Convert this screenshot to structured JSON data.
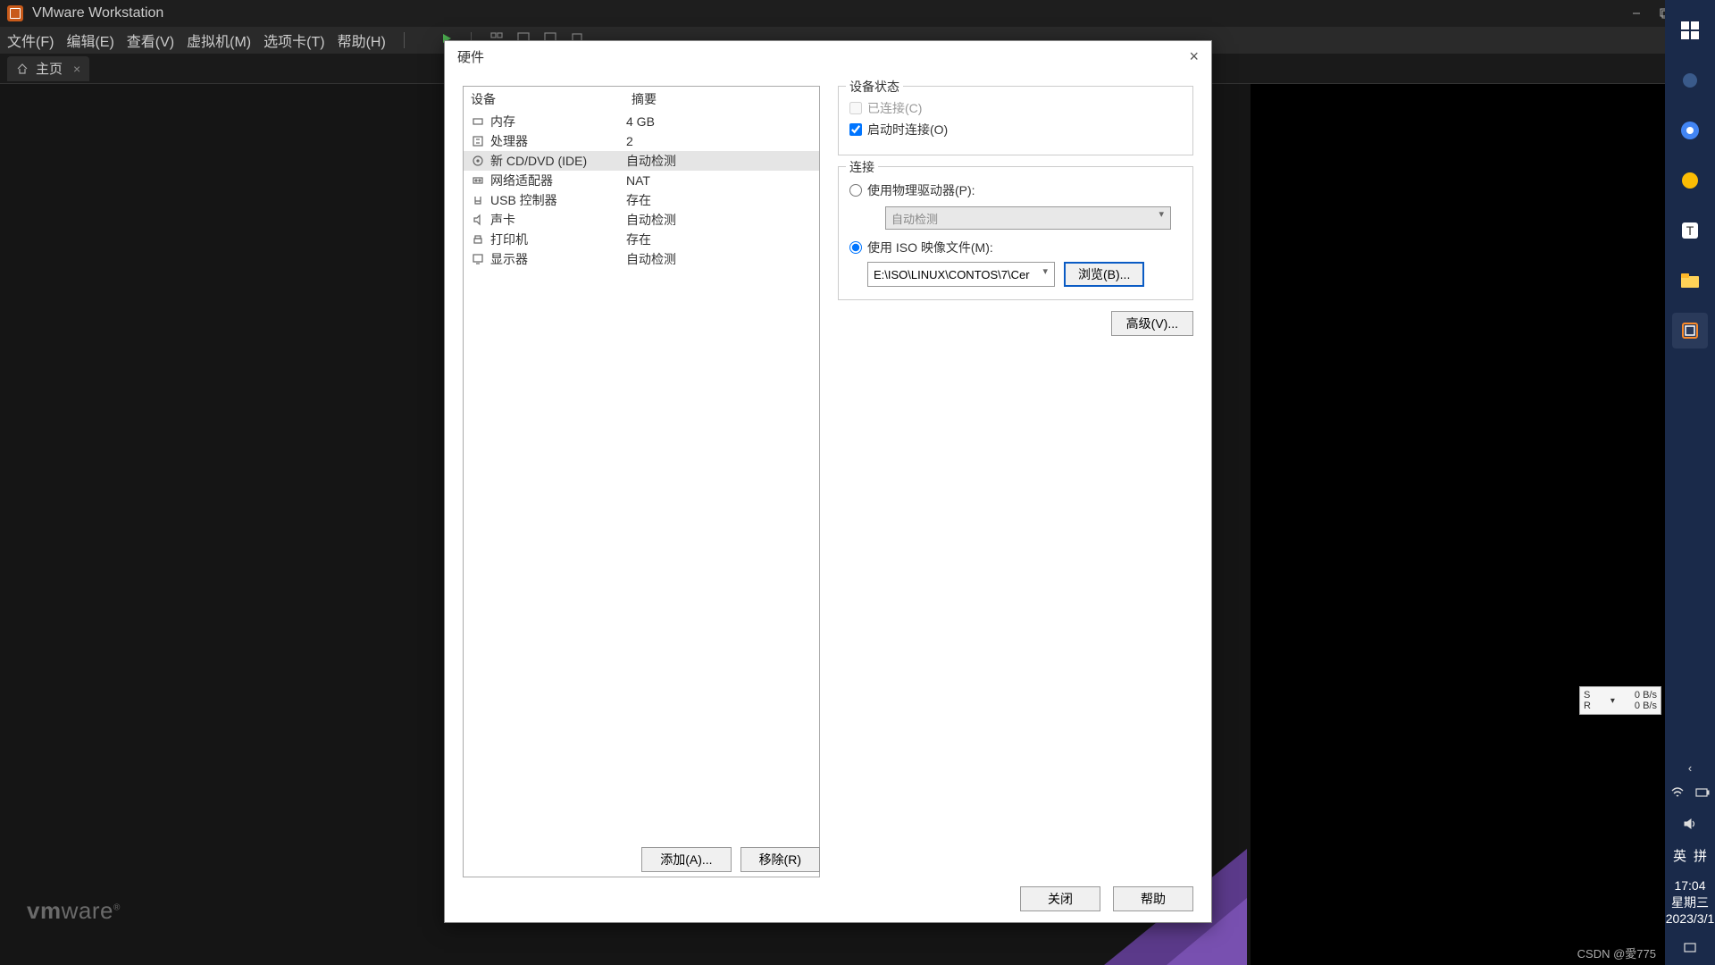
{
  "app": {
    "title": "VMware Workstation"
  },
  "menu": {
    "file": "文件(F)",
    "edit": "编辑(E)",
    "view": "查看(V)",
    "vm": "虚拟机(M)",
    "tabs": "选项卡(T)",
    "help": "帮助(H)"
  },
  "tab": {
    "home": "主页"
  },
  "logo": {
    "brand": "vm",
    "suffix": "ware"
  },
  "dialog": {
    "title": "硬件",
    "device_header": "设备",
    "summary_header": "摘要",
    "devices": [
      {
        "name": "内存",
        "summary": "4 GB"
      },
      {
        "name": "处理器",
        "summary": "2"
      },
      {
        "name": "新 CD/DVD (IDE)",
        "summary": "自动检测"
      },
      {
        "name": "网络适配器",
        "summary": "NAT"
      },
      {
        "name": "USB 控制器",
        "summary": "存在"
      },
      {
        "name": "声卡",
        "summary": "自动检测"
      },
      {
        "name": "打印机",
        "summary": "存在"
      },
      {
        "name": "显示器",
        "summary": "自动检测"
      }
    ],
    "status_group": "设备状态",
    "connected": "已连接(C)",
    "connect_on_start": "启动时连接(O)",
    "connection_group": "连接",
    "use_physical": "使用物理驱动器(P):",
    "auto_detect": "自动检测",
    "use_iso": "使用 ISO 映像文件(M):",
    "iso_path": "E:\\ISO\\LINUX\\CONTOS\\7\\Cer",
    "browse": "浏览(B)...",
    "advanced": "高级(V)...",
    "add": "添加(A)...",
    "remove": "移除(R)",
    "close": "关闭",
    "help": "帮助"
  },
  "taskbar": {
    "time": "17:04",
    "day": "星期三",
    "date": "2023/3/1",
    "ime_lang": "英",
    "ime_mode": "拼",
    "net_s": "S",
    "net_r": "R",
    "net_up": "0 B/s",
    "net_down": "0 B/s"
  },
  "watermark": "CSDN @愛775"
}
